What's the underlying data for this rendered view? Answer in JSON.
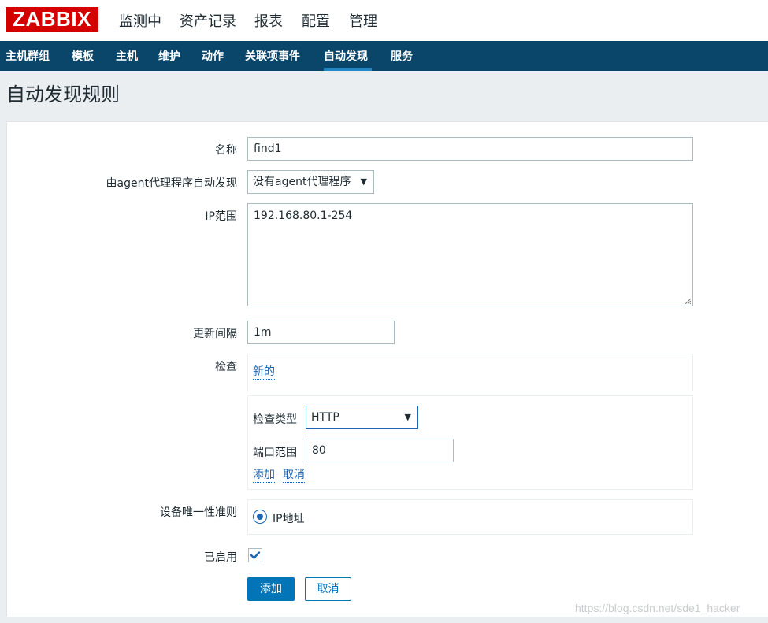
{
  "logo": "ZABBIX",
  "top_menu": [
    "监测中",
    "资产记录",
    "报表",
    "配置",
    "管理"
  ],
  "sub_menu": [
    "主机群组",
    "模板",
    "主机",
    "维护",
    "动作",
    "关联项事件",
    "自动发现",
    "服务"
  ],
  "sub_menu_active": "自动发现",
  "page_title": "自动发现规则",
  "form": {
    "name_label": "名称",
    "name_value": "find1",
    "proxy_label": "由agent代理程序自动发现",
    "proxy_value": "没有agent代理程序",
    "ip_range_label": "IP范围",
    "ip_range_value": "192.168.80.1-254",
    "interval_label": "更新间隔",
    "interval_value": "1m",
    "checks_label": "检查",
    "checks_new_link": "新的",
    "check_type_label": "检查类型",
    "check_type_value": "HTTP",
    "port_range_label": "端口范围",
    "port_range_value": "80",
    "check_add_link": "添加",
    "check_cancel_link": "取消",
    "uniqueness_label": "设备唯一性准则",
    "uniqueness_option": "IP地址",
    "enabled_label": "已启用",
    "enabled_checked": true,
    "add_button": "添加",
    "cancel_button": "取消"
  },
  "watermark": "https://blog.csdn.net/sde1_hacker",
  "colors": {
    "logo_bg": "#d40000",
    "nav_bg": "#0a466a",
    "accent": "#1f65b3",
    "primary_button": "#0275b8"
  },
  "icons": {
    "dropdown": "caret-down-icon",
    "check": "checkmark-icon"
  }
}
